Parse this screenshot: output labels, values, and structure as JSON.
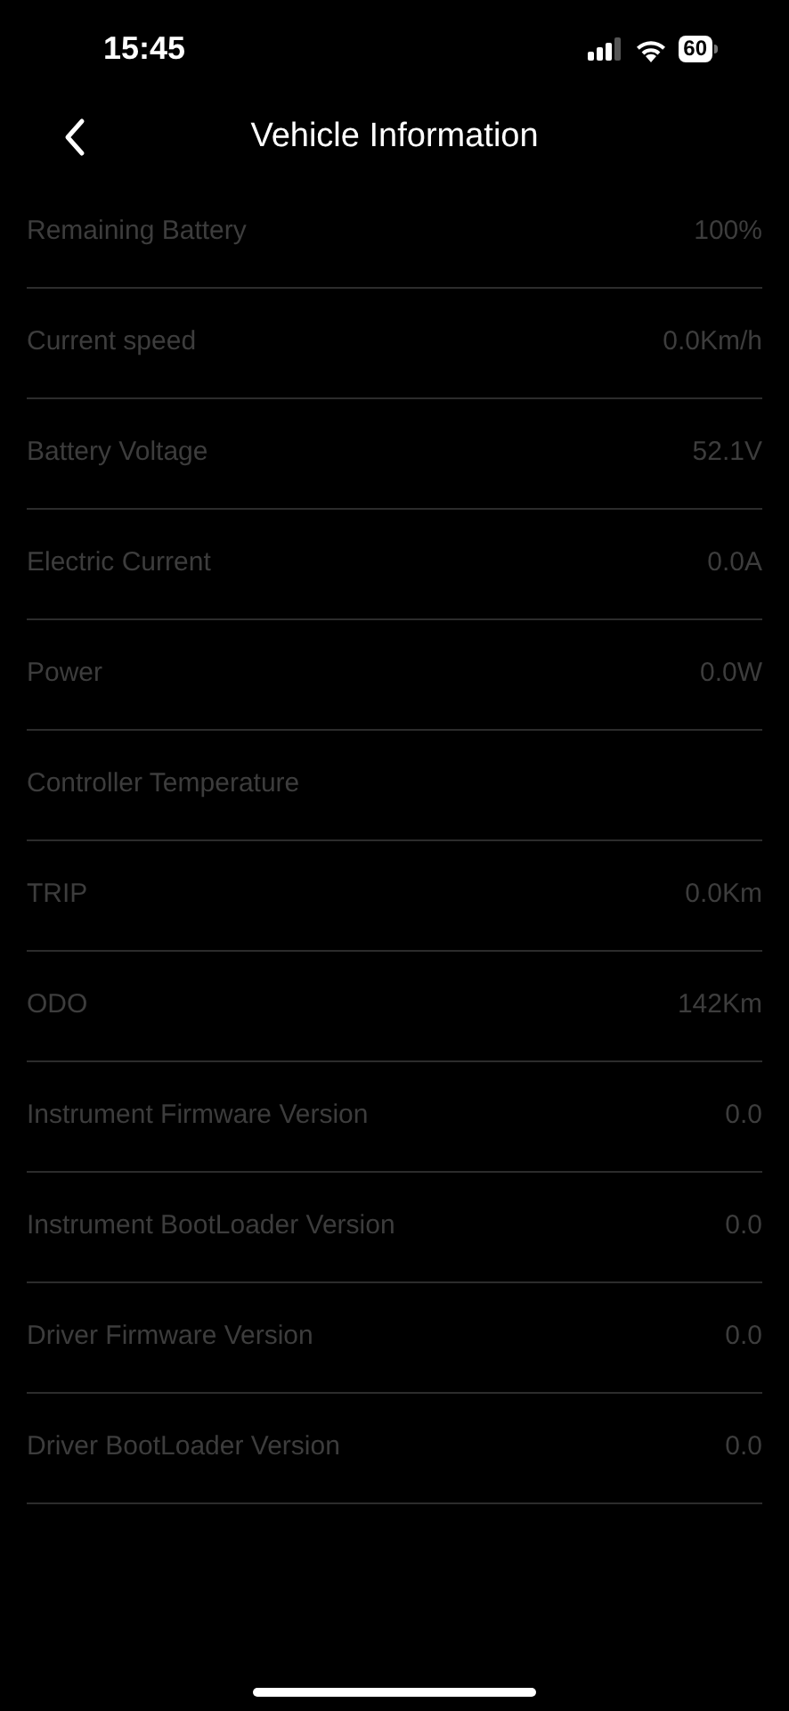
{
  "status_bar": {
    "time": "15:45",
    "battery": "60"
  },
  "header": {
    "title": "Vehicle Information"
  },
  "rows": [
    {
      "label": "Remaining Battery",
      "value": "100%"
    },
    {
      "label": "Current speed",
      "value": "0.0Km/h"
    },
    {
      "label": "Battery Voltage",
      "value": "52.1V"
    },
    {
      "label": "Electric Current",
      "value": "0.0A"
    },
    {
      "label": "Power",
      "value": "0.0W"
    },
    {
      "label": "Controller Temperature"
    },
    {
      "label": "TRIP",
      "value": "0.0Km"
    },
    {
      "label": "ODO",
      "value": "142Km"
    },
    {
      "label": "Instrument Firmware Version",
      "value": "0.0"
    },
    {
      "label": "Instrument BootLoader Version",
      "value": "0.0"
    },
    {
      "label": "Driver Firmware Version",
      "value": "0.0"
    },
    {
      "label": "Driver BootLoader Version",
      "value": "0.0"
    }
  ]
}
